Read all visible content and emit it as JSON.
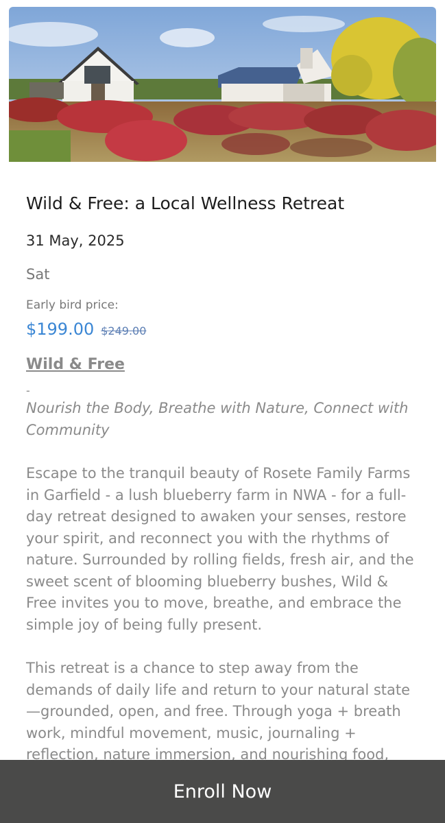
{
  "event": {
    "title": "Wild & Free: a Local Wellness Retreat",
    "date": "31 May, 2025",
    "day": "Sat",
    "price_label": "Early bird price:",
    "price_current": "$199.00",
    "price_original": "$249.00"
  },
  "description": {
    "heading": "Wild & Free",
    "dash": "-",
    "tagline": "Nourish the Body, Breathe with Nature, Connect with Community",
    "paragraph1": "Escape to the tranquil beauty of Rosete Family Farms in Garfield - a lush blueberry farm in NWA - for a full-day retreat designed to awaken your senses, restore your spirit, and reconnect you with the rhythms of nature. Surrounded by rolling fields, fresh air, and the sweet scent of blooming blueberry bushes, Wild & Free invites you to move, breathe, and embrace the simple joy of being fully present.",
    "paragraph2": "This retreat is a chance to step away from the demands of daily life and return to your natural state—grounded, open, and free. Through yoga + breath work, mindful movement, music, journaling + reflection, nature immersion, and nourishing food,"
  },
  "cta": {
    "enroll_label": "Enroll Now"
  },
  "colors": {
    "price_accent": "#3a86d4",
    "cta_background": "#4a4a49"
  }
}
